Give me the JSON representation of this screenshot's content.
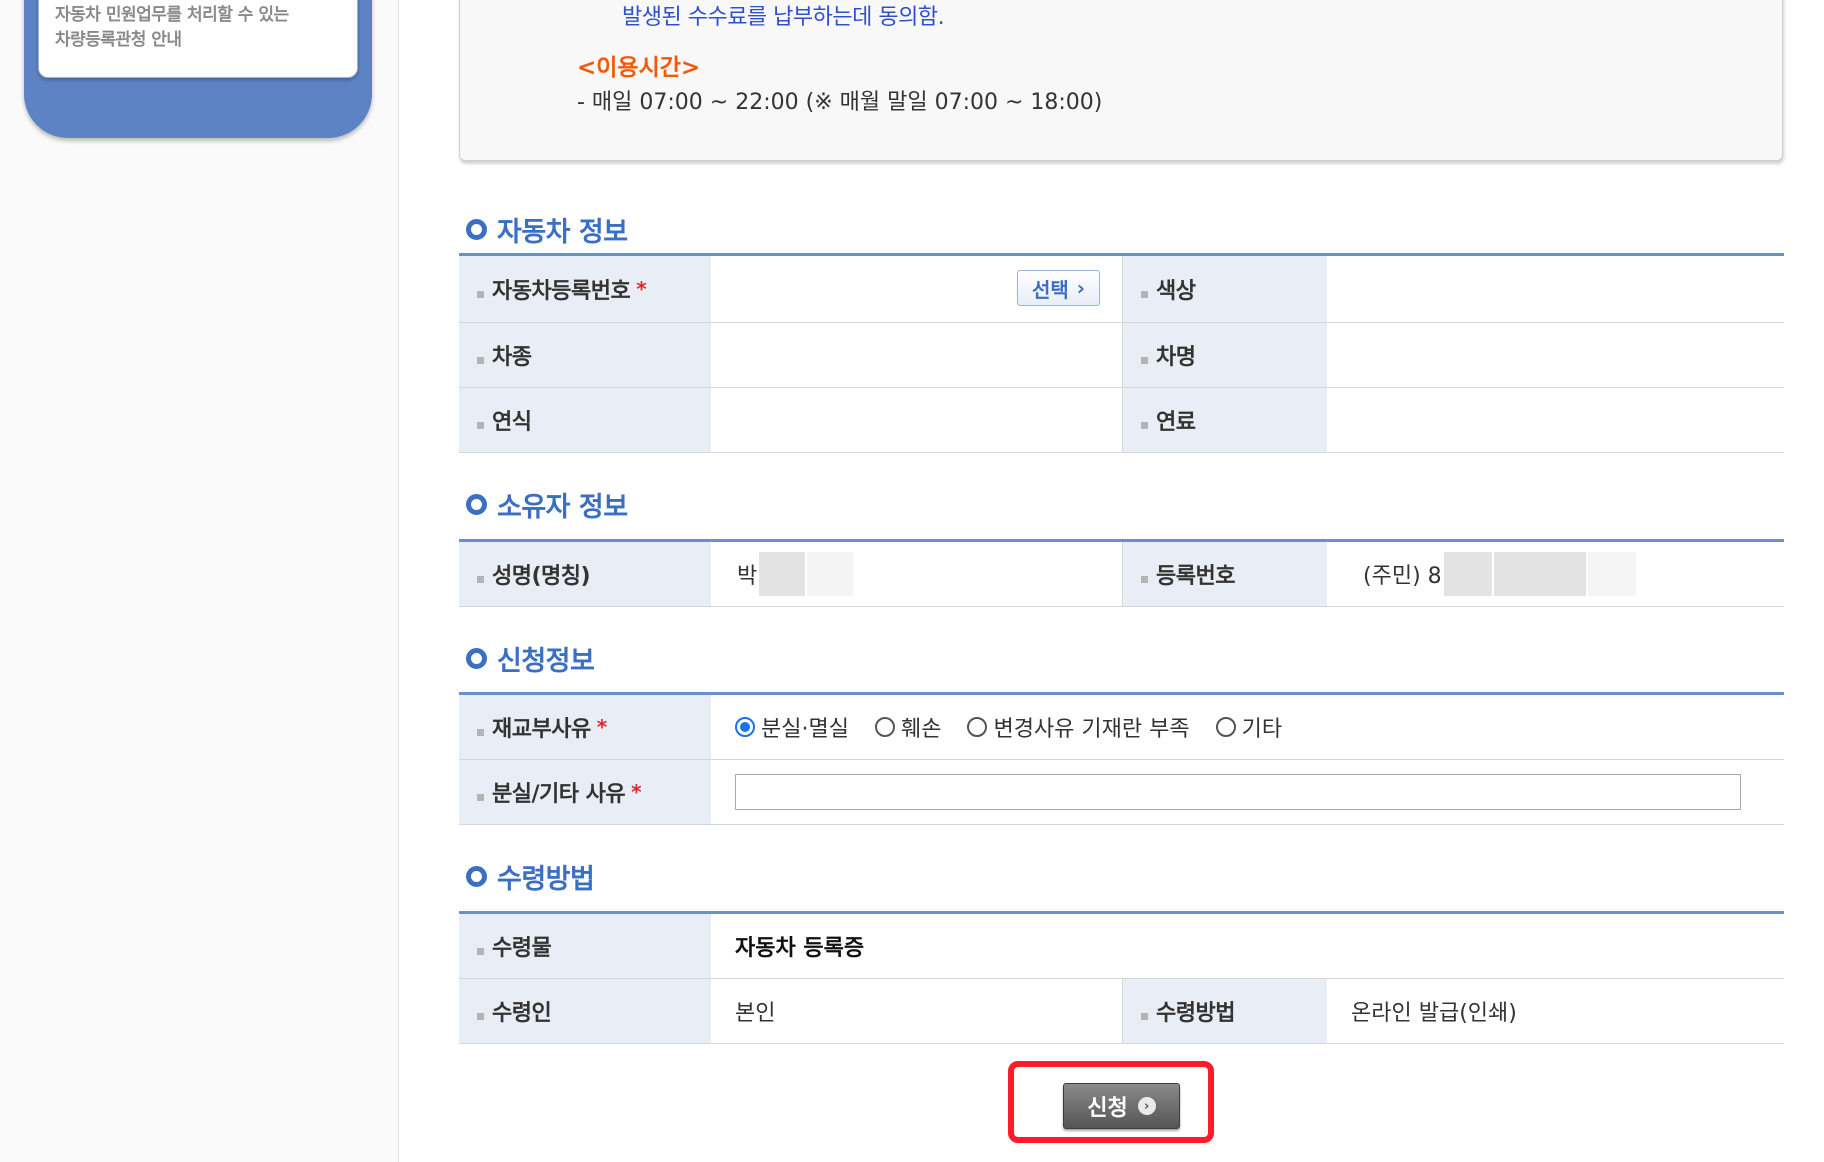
{
  "sidebar": {
    "card_text": "자동차 민원업무를 처리할 수 있는\n차량등록관청 안내"
  },
  "notice": {
    "line1": "발생된 수수료를 납부하는데 동의함.",
    "time_title": "<이용시간>",
    "time_text": "- 매일 07:00 ~ 22:00 (※ 매월 말일 07:00 ~ 18:00)"
  },
  "vehicle": {
    "title": "자동차 정보",
    "reg_no_label": "자동차등록번호",
    "required_mark": "*",
    "select_button": "선택",
    "select_arrow": "›",
    "color_label": "색상",
    "type_label": "차종",
    "name_label": "차명",
    "year_label": "연식",
    "fuel_label": "연료"
  },
  "owner": {
    "title": "소유자 정보",
    "name_label": "성명(명칭)",
    "name_value": "박",
    "reg_label": "등록번호",
    "reg_value": "(주민) 8"
  },
  "application": {
    "title": "신청정보",
    "reason_label": "재교부사유",
    "reasons": [
      "분실·멸실",
      "훼손",
      "변경사유 기재란 부족",
      "기타"
    ],
    "selected_reason": "분실·멸실",
    "other_reason_label": "분실/기타 사유",
    "other_reason_value": ""
  },
  "receipt": {
    "title": "수령방법",
    "item_label": "수령물",
    "item_value": "자동차 등록증",
    "receiver_label": "수령인",
    "receiver_value": "본인",
    "method_label": "수령방법",
    "method_value": "온라인 발급(인쇄)"
  },
  "submit": {
    "label": "신청",
    "arrow": "›"
  },
  "colors": {
    "accent_blue": "#3a6fc2",
    "header_cell": "#e9eef6",
    "highlight_red": "#ff1b2a",
    "notice_orange": "#f05a0a"
  }
}
